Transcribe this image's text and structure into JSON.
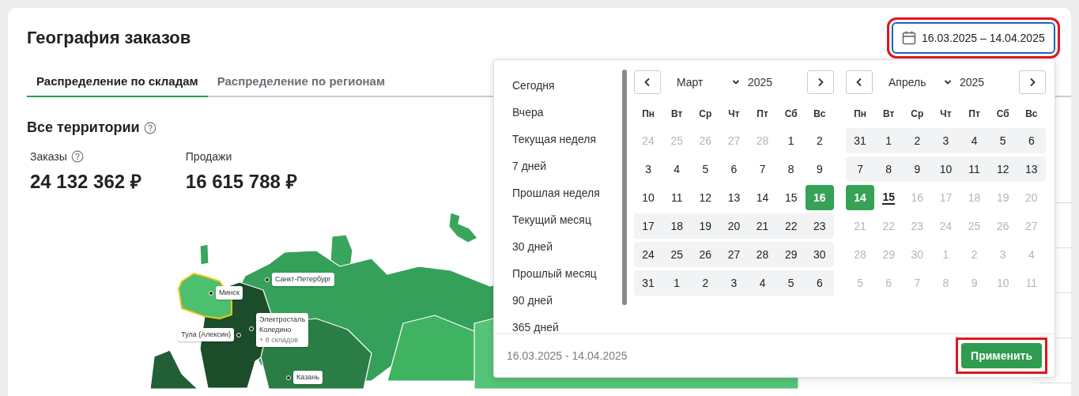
{
  "title": "География заказов",
  "date_field": {
    "value": "16.03.2025 – 14.04.2025",
    "highlighted": true
  },
  "tabs": [
    {
      "label": "Распределение по складам",
      "selected": true
    },
    {
      "label": "Распределение по регионам",
      "selected": false
    }
  ],
  "section_title": "Все территории",
  "stats": [
    {
      "label": "Заказы",
      "value": "24 132 362 ₽",
      "help": true
    },
    {
      "label": "Продажи",
      "value": "16 615 788 ₽",
      "help": false
    }
  ],
  "map_pins": [
    {
      "lines": [
        "Санкт-Петербург"
      ]
    },
    {
      "lines": [
        "Минск"
      ]
    },
    {
      "lines": [
        "Электросталь",
        "Коледино"
      ],
      "more": "+ 8 складов"
    },
    {
      "lines": [
        "Тула (Алексин)"
      ]
    },
    {
      "lines": [
        "Казань"
      ]
    }
  ],
  "date_picker": {
    "presets": [
      "Сегодня",
      "Вчера",
      "Текущая неделя",
      "7 дней",
      "Прошлая неделя",
      "Текущий месяц",
      "30 дней",
      "Прошлый месяц",
      "90 дней",
      "365 дней"
    ],
    "calendars": [
      {
        "month": "Март",
        "year": "2025",
        "weekdays": [
          "Пн",
          "Вт",
          "Ср",
          "Чт",
          "Пт",
          "Сб",
          "Вс"
        ],
        "weeks": [
          {
            "in_range": false,
            "days": [
              {
                "label": "24",
                "muted": true,
                "selected": false,
                "today": false
              },
              {
                "label": "25",
                "muted": true,
                "selected": false,
                "today": false
              },
              {
                "label": "26",
                "muted": true,
                "selected": false,
                "today": false
              },
              {
                "label": "27",
                "muted": true,
                "selected": false,
                "today": false
              },
              {
                "label": "28",
                "muted": true,
                "selected": false,
                "today": false
              },
              {
                "label": "1",
                "muted": false,
                "selected": false,
                "today": false
              },
              {
                "label": "2",
                "muted": false,
                "selected": false,
                "today": false
              }
            ]
          },
          {
            "in_range": false,
            "days": [
              {
                "label": "3",
                "muted": false,
                "selected": false,
                "today": false
              },
              {
                "label": "4",
                "muted": false,
                "selected": false,
                "today": false
              },
              {
                "label": "5",
                "muted": false,
                "selected": false,
                "today": false
              },
              {
                "label": "6",
                "muted": false,
                "selected": false,
                "today": false
              },
              {
                "label": "7",
                "muted": false,
                "selected": false,
                "today": false
              },
              {
                "label": "8",
                "muted": false,
                "selected": false,
                "today": false
              },
              {
                "label": "9",
                "muted": false,
                "selected": false,
                "today": false
              }
            ]
          },
          {
            "in_range": false,
            "days": [
              {
                "label": "10",
                "muted": false,
                "selected": false,
                "today": false
              },
              {
                "label": "11",
                "muted": false,
                "selected": false,
                "today": false
              },
              {
                "label": "12",
                "muted": false,
                "selected": false,
                "today": false
              },
              {
                "label": "13",
                "muted": false,
                "selected": false,
                "today": false
              },
              {
                "label": "14",
                "muted": false,
                "selected": false,
                "today": false
              },
              {
                "label": "15",
                "muted": false,
                "selected": false,
                "today": false
              },
              {
                "label": "16",
                "muted": false,
                "selected": true,
                "today": false
              }
            ]
          },
          {
            "in_range": true,
            "days": [
              {
                "label": "17",
                "muted": false,
                "selected": false,
                "today": false
              },
              {
                "label": "18",
                "muted": false,
                "selected": false,
                "today": false
              },
              {
                "label": "19",
                "muted": false,
                "selected": false,
                "today": false
              },
              {
                "label": "20",
                "muted": false,
                "selected": false,
                "today": false
              },
              {
                "label": "21",
                "muted": false,
                "selected": false,
                "today": false
              },
              {
                "label": "22",
                "muted": false,
                "selected": false,
                "today": false
              },
              {
                "label": "23",
                "muted": false,
                "selected": false,
                "today": false
              }
            ]
          },
          {
            "in_range": true,
            "days": [
              {
                "label": "24",
                "muted": false,
                "selected": false,
                "today": false
              },
              {
                "label": "25",
                "muted": false,
                "selected": false,
                "today": false
              },
              {
                "label": "26",
                "muted": false,
                "selected": false,
                "today": false
              },
              {
                "label": "27",
                "muted": false,
                "selected": false,
                "today": false
              },
              {
                "label": "28",
                "muted": false,
                "selected": false,
                "today": false
              },
              {
                "label": "29",
                "muted": false,
                "selected": false,
                "today": false
              },
              {
                "label": "30",
                "muted": false,
                "selected": false,
                "today": false
              }
            ]
          },
          {
            "in_range": true,
            "days": [
              {
                "label": "31",
                "muted": false,
                "selected": false,
                "today": false
              },
              {
                "label": "1",
                "muted": false,
                "selected": false,
                "today": false
              },
              {
                "label": "2",
                "muted": false,
                "selected": false,
                "today": false
              },
              {
                "label": "3",
                "muted": false,
                "selected": false,
                "today": false
              },
              {
                "label": "4",
                "muted": false,
                "selected": false,
                "today": false
              },
              {
                "label": "5",
                "muted": false,
                "selected": false,
                "today": false
              },
              {
                "label": "6",
                "muted": false,
                "selected": false,
                "today": false
              }
            ]
          }
        ]
      },
      {
        "month": "Апрель",
        "year": "2025",
        "weekdays": [
          "Пн",
          "Вт",
          "Ср",
          "Чт",
          "Пт",
          "Сб",
          "Вс"
        ],
        "weeks": [
          {
            "in_range": true,
            "days": [
              {
                "label": "31",
                "muted": false,
                "selected": false,
                "today": false
              },
              {
                "label": "1",
                "muted": false,
                "selected": false,
                "today": false
              },
              {
                "label": "2",
                "muted": false,
                "selected": false,
                "today": false
              },
              {
                "label": "3",
                "muted": false,
                "selected": false,
                "today": false
              },
              {
                "label": "4",
                "muted": false,
                "selected": false,
                "today": false
              },
              {
                "label": "5",
                "muted": false,
                "selected": false,
                "today": false
              },
              {
                "label": "6",
                "muted": false,
                "selected": false,
                "today": false
              }
            ]
          },
          {
            "in_range": true,
            "days": [
              {
                "label": "7",
                "muted": false,
                "selected": false,
                "today": false
              },
              {
                "label": "8",
                "muted": false,
                "selected": false,
                "today": false
              },
              {
                "label": "9",
                "muted": false,
                "selected": false,
                "today": false
              },
              {
                "label": "10",
                "muted": false,
                "selected": false,
                "today": false
              },
              {
                "label": "11",
                "muted": false,
                "selected": false,
                "today": false
              },
              {
                "label": "12",
                "muted": false,
                "selected": false,
                "today": false
              },
              {
                "label": "13",
                "muted": false,
                "selected": false,
                "today": false
              }
            ]
          },
          {
            "in_range": false,
            "days": [
              {
                "label": "14",
                "muted": false,
                "selected": true,
                "today": false
              },
              {
                "label": "15",
                "muted": false,
                "selected": false,
                "today": true
              },
              {
                "label": "16",
                "muted": true,
                "selected": false,
                "today": false
              },
              {
                "label": "17",
                "muted": true,
                "selected": false,
                "today": false
              },
              {
                "label": "18",
                "muted": true,
                "selected": false,
                "today": false
              },
              {
                "label": "19",
                "muted": true,
                "selected": false,
                "today": false
              },
              {
                "label": "20",
                "muted": true,
                "selected": false,
                "today": false
              }
            ]
          },
          {
            "in_range": false,
            "days": [
              {
                "label": "21",
                "muted": true,
                "selected": false,
                "today": false
              },
              {
                "label": "22",
                "muted": true,
                "selected": false,
                "today": false
              },
              {
                "label": "23",
                "muted": true,
                "selected": false,
                "today": false
              },
              {
                "label": "24",
                "muted": true,
                "selected": false,
                "today": false
              },
              {
                "label": "25",
                "muted": true,
                "selected": false,
                "today": false
              },
              {
                "label": "26",
                "muted": true,
                "selected": false,
                "today": false
              },
              {
                "label": "27",
                "muted": true,
                "selected": false,
                "today": false
              }
            ]
          },
          {
            "in_range": false,
            "days": [
              {
                "label": "28",
                "muted": true,
                "selected": false,
                "today": false
              },
              {
                "label": "29",
                "muted": true,
                "selected": false,
                "today": false
              },
              {
                "label": "30",
                "muted": true,
                "selected": false,
                "today": false
              },
              {
                "label": "1",
                "muted": true,
                "selected": false,
                "today": false
              },
              {
                "label": "2",
                "muted": true,
                "selected": false,
                "today": false
              },
              {
                "label": "3",
                "muted": true,
                "selected": false,
                "today": false
              },
              {
                "label": "4",
                "muted": true,
                "selected": false,
                "today": false
              }
            ]
          },
          {
            "in_range": false,
            "days": [
              {
                "label": "5",
                "muted": true,
                "selected": false,
                "today": false
              },
              {
                "label": "6",
                "muted": true,
                "selected": false,
                "today": false
              },
              {
                "label": "7",
                "muted": true,
                "selected": false,
                "today": false
              },
              {
                "label": "8",
                "muted": true,
                "selected": false,
                "today": false
              },
              {
                "label": "9",
                "muted": true,
                "selected": false,
                "today": false
              },
              {
                "label": "10",
                "muted": true,
                "selected": false,
                "today": false
              },
              {
                "label": "11",
                "muted": true,
                "selected": false,
                "today": false
              }
            ]
          }
        ]
      }
    ],
    "range_text": "16.03.2025 - 14.04.2025",
    "apply_button": {
      "label": "Применить",
      "highlighted": true
    }
  }
}
